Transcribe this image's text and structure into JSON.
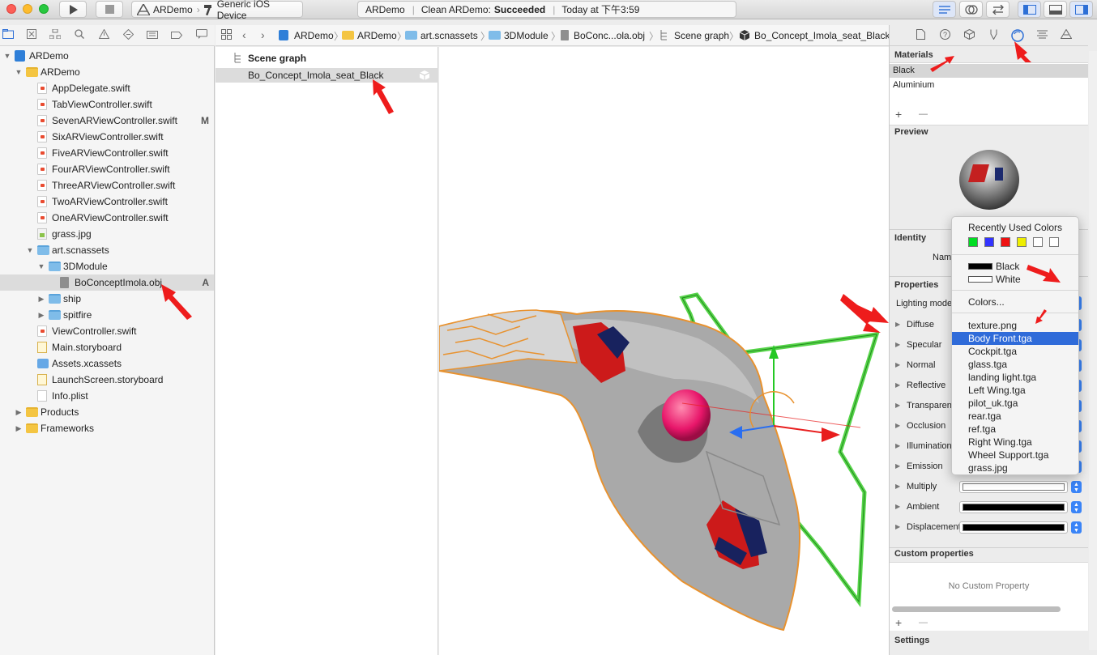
{
  "toolbar": {
    "scheme_target": "ARDemo",
    "scheme_device": "Generic iOS Device",
    "activity_project": "ARDemo",
    "activity_status_prefix": "Clean ARDemo:",
    "activity_status_result": "Succeeded",
    "activity_time": "Today at 下午3:59"
  },
  "navigator": {
    "items": [
      {
        "label": "ARDemo",
        "badge": ""
      },
      {
        "label": "ARDemo",
        "badge": ""
      },
      {
        "label": "AppDelegate.swift",
        "badge": ""
      },
      {
        "label": "TabViewController.swift",
        "badge": ""
      },
      {
        "label": "SevenARViewController.swift",
        "badge": "M"
      },
      {
        "label": "SixARViewController.swift",
        "badge": ""
      },
      {
        "label": "FiveARViewController.swift",
        "badge": ""
      },
      {
        "label": "FourARViewController.swift",
        "badge": ""
      },
      {
        "label": "ThreeARViewController.swift",
        "badge": ""
      },
      {
        "label": "TwoARViewController.swift",
        "badge": ""
      },
      {
        "label": "OneARViewController.swift",
        "badge": ""
      },
      {
        "label": "grass.jpg",
        "badge": ""
      },
      {
        "label": "art.scnassets",
        "badge": ""
      },
      {
        "label": "3DModule",
        "badge": ""
      },
      {
        "label": "BoConceptImola.obj",
        "badge": "A"
      },
      {
        "label": "ship",
        "badge": ""
      },
      {
        "label": "spitfire",
        "badge": ""
      },
      {
        "label": "ViewController.swift",
        "badge": ""
      },
      {
        "label": "Main.storyboard",
        "badge": ""
      },
      {
        "label": "Assets.xcassets",
        "badge": ""
      },
      {
        "label": "LaunchScreen.storyboard",
        "badge": ""
      },
      {
        "label": "Info.plist",
        "badge": ""
      },
      {
        "label": "Products",
        "badge": ""
      },
      {
        "label": "Frameworks",
        "badge": ""
      }
    ]
  },
  "jumpbar": {
    "crumbs": [
      "ARDemo",
      "ARDemo",
      "art.scnassets",
      "3DModule",
      "BoConc...ola.obj",
      "Scene graph",
      "Bo_Concept_Imola_seat_Black"
    ]
  },
  "outline": {
    "header": "Scene graph",
    "node": "Bo_Concept_Imola_seat_Black"
  },
  "inspector": {
    "materials_title": "Materials",
    "materials": [
      "Black",
      "Aluminium"
    ],
    "add_symbol": "+",
    "remove_symbol": "—",
    "preview_title": "Preview",
    "identity_title": "Identity",
    "name_label": "Name",
    "properties_title": "Properties",
    "lighting_label": "Lighting model",
    "props": [
      "Diffuse",
      "Specular",
      "Normal",
      "Reflective",
      "Transparent",
      "Occlusion",
      "Illumination",
      "Emission",
      "Multiply",
      "Ambient",
      "Displacement"
    ],
    "custom_title": "Custom properties",
    "no_custom": "No Custom Property",
    "settings_title": "Settings"
  },
  "popup": {
    "recent_title": "Recently Used Colors",
    "recent_colors": [
      "#00dd22",
      "#3333ff",
      "#ee1111",
      "#eeee00",
      "#ffffff",
      "#ffffff"
    ],
    "named": [
      {
        "label": "Black",
        "color": "#000000"
      },
      {
        "label": "White",
        "color": "#ffffff"
      }
    ],
    "colors_item": "Colors...",
    "textures": [
      "texture.png",
      "Body Front.tga",
      "Cockpit.tga",
      "glass.tga",
      "landing light.tga",
      "Left Wing.tga",
      "pilot_uk.tga",
      "rear.tga",
      "ref.tga",
      "Right Wing.tga",
      "Wheel Support.tga",
      "grass.jpg"
    ],
    "highlighted_index": 1
  },
  "colors": {
    "accent": "#3a84f7",
    "annotation_arrow": "#ee1c1c",
    "selection_highlight": "#2f6bd9"
  }
}
